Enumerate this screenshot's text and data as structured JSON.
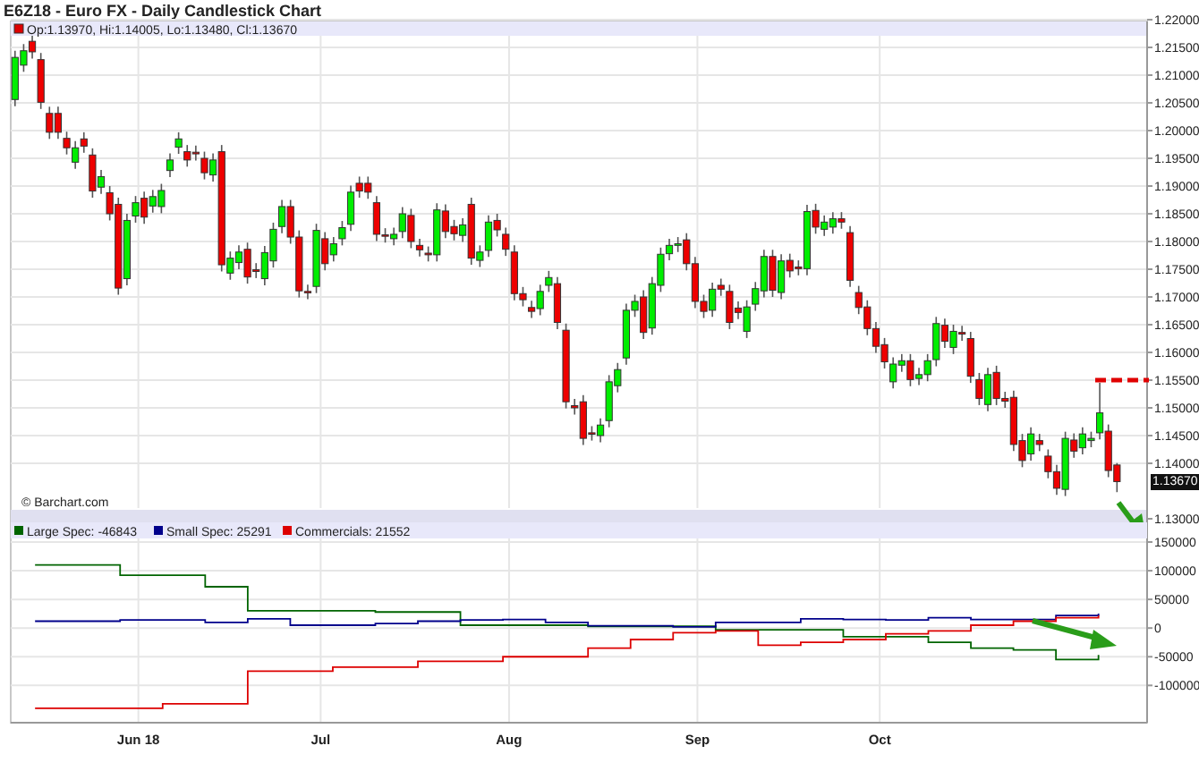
{
  "title": "E6Z18 - Euro FX - Daily Candlestick Chart",
  "price_chart": {
    "info": "Op:1.13970, Hi:1.14005, Lo:1.13480, Cl:1.13670",
    "copyright": "© Barchart.com",
    "last_price_label": "1.13670",
    "chart_data": {
      "type": "candlestick",
      "grid": true,
      "ylim": [
        1.13,
        1.22
      ],
      "categories": [
        null,
        null,
        null,
        null,
        null,
        null,
        null,
        null,
        null,
        null,
        null,
        null,
        null,
        null,
        null,
        null,
        null,
        null,
        null,
        null,
        null,
        null,
        null,
        null,
        null,
        null,
        null,
        null,
        null,
        null,
        null,
        null,
        null,
        null,
        null,
        null,
        null,
        null,
        null,
        null,
        null,
        null,
        null,
        null,
        null,
        null,
        null,
        null,
        null,
        null,
        null,
        null,
        null,
        null,
        null,
        null,
        null,
        null,
        null,
        null,
        null,
        null,
        null,
        null,
        null,
        null,
        null,
        null,
        null,
        null,
        null,
        null,
        null,
        null,
        null,
        null,
        null,
        null,
        null,
        null,
        null,
        null,
        null,
        null,
        null,
        null,
        null,
        null,
        null,
        null,
        null,
        null,
        null,
        null,
        null,
        null,
        null,
        null,
        null,
        null,
        null,
        null,
        null,
        null,
        null,
        null,
        null,
        null,
        null,
        null,
        null,
        null,
        null,
        null,
        null,
        null,
        null,
        null,
        null,
        null,
        null,
        null,
        null,
        null,
        null,
        null,
        null,
        null,
        null,
        null,
        null,
        null
      ],
      "ohlc": [
        [
          1.2056,
          1.2144,
          1.2044,
          1.2132
        ],
        [
          1.2118,
          1.2156,
          1.2106,
          1.2144
        ],
        [
          1.2161,
          1.2173,
          1.213,
          1.2142
        ],
        [
          1.2128,
          1.214,
          1.2039,
          1.2051
        ],
        [
          1.2031,
          1.2043,
          1.1985,
          1.1997
        ],
        [
          1.2031,
          1.2043,
          1.1985,
          1.1997
        ],
        [
          1.1986,
          1.1998,
          1.1957,
          1.1969
        ],
        [
          1.1943,
          1.1981,
          1.1931,
          1.1969
        ],
        [
          1.1985,
          1.1997,
          1.196,
          1.1972
        ],
        [
          1.1956,
          1.1968,
          1.1879,
          1.1891
        ],
        [
          1.1898,
          1.1929,
          1.1886,
          1.1917
        ],
        [
          1.1888,
          1.19,
          1.1838,
          1.185
        ],
        [
          1.1867,
          1.1879,
          1.1704,
          1.1716
        ],
        [
          1.1733,
          1.185,
          1.1721,
          1.1838
        ],
        [
          1.1846,
          1.1882,
          1.1834,
          1.187
        ],
        [
          1.1878,
          1.189,
          1.1832,
          1.1844
        ],
        [
          1.1864,
          1.1893,
          1.1852,
          1.1881
        ],
        [
          1.1863,
          1.1904,
          1.1851,
          1.1892
        ],
        [
          1.1928,
          1.1959,
          1.1916,
          1.1947
        ],
        [
          1.197,
          1.1997,
          1.1958,
          1.1985
        ],
        [
          1.1962,
          1.1974,
          1.1935,
          1.1947
        ],
        [
          1.1961,
          1.1973,
          1.1946,
          1.1958
        ],
        [
          1.195,
          1.1962,
          1.1912,
          1.1924
        ],
        [
          1.192,
          1.1959,
          1.1908,
          1.1947
        ],
        [
          1.1962,
          1.1974,
          1.1746,
          1.1758
        ],
        [
          1.1743,
          1.1782,
          1.1731,
          1.177
        ],
        [
          1.1762,
          1.1793,
          1.175,
          1.1781
        ],
        [
          1.1786,
          1.1798,
          1.1724,
          1.1736
        ],
        [
          1.1749,
          1.1761,
          1.1734,
          1.1746
        ],
        [
          1.1733,
          1.1792,
          1.1721,
          1.178
        ],
        [
          1.1765,
          1.1834,
          1.1753,
          1.1822
        ],
        [
          1.1827,
          1.1875,
          1.1815,
          1.1863
        ],
        [
          1.1863,
          1.1875,
          1.1796,
          1.1808
        ],
        [
          1.1808,
          1.182,
          1.1699,
          1.1711
        ],
        [
          1.171,
          1.1722,
          1.1696,
          1.1708
        ],
        [
          1.1719,
          1.1832,
          1.1707,
          1.182
        ],
        [
          1.1805,
          1.1817,
          1.1748,
          1.176
        ],
        [
          1.1776,
          1.1808,
          1.1764,
          1.1796
        ],
        [
          1.1805,
          1.1837,
          1.1793,
          1.1825
        ],
        [
          1.1831,
          1.1901,
          1.1819,
          1.1889
        ],
        [
          1.1905,
          1.1917,
          1.1879,
          1.1891
        ],
        [
          1.1905,
          1.1917,
          1.1877,
          1.1889
        ],
        [
          1.187,
          1.1882,
          1.1801,
          1.1813
        ],
        [
          1.1812,
          1.1824,
          1.1798,
          1.181
        ],
        [
          1.1805,
          1.1825,
          1.1793,
          1.1813
        ],
        [
          1.1818,
          1.1862,
          1.1806,
          1.185
        ],
        [
          1.1847,
          1.1859,
          1.1788,
          1.18
        ],
        [
          1.1793,
          1.1805,
          1.1773,
          1.1785
        ],
        [
          1.1779,
          1.1791,
          1.1764,
          1.1776
        ],
        [
          1.1776,
          1.1869,
          1.1764,
          1.1857
        ],
        [
          1.1855,
          1.1867,
          1.1806,
          1.1818
        ],
        [
          1.1827,
          1.1839,
          1.1802,
          1.1814
        ],
        [
          1.1811,
          1.1842,
          1.1799,
          1.183
        ],
        [
          1.1867,
          1.1879,
          1.1758,
          1.177
        ],
        [
          1.1766,
          1.1793,
          1.1754,
          1.1781
        ],
        [
          1.1784,
          1.1847,
          1.1772,
          1.1835
        ],
        [
          1.1838,
          1.185,
          1.1809,
          1.1821
        ],
        [
          1.1813,
          1.1825,
          1.1774,
          1.1786
        ],
        [
          1.1781,
          1.1793,
          1.1694,
          1.1706
        ],
        [
          1.1706,
          1.1718,
          1.1683,
          1.1695
        ],
        [
          1.1681,
          1.1693,
          1.1662,
          1.1674
        ],
        [
          1.1679,
          1.1722,
          1.1667,
          1.171
        ],
        [
          1.1721,
          1.1747,
          1.1709,
          1.1735
        ],
        [
          1.1724,
          1.1736,
          1.1642,
          1.1654
        ],
        [
          1.164,
          1.1652,
          1.1499,
          1.1511
        ],
        [
          1.1504,
          1.1516,
          1.1488,
          1.15
        ],
        [
          1.1511,
          1.1523,
          1.1433,
          1.1445
        ],
        [
          1.1455,
          1.1467,
          1.1441,
          1.1453
        ],
        [
          1.145,
          1.1481,
          1.1438,
          1.1469
        ],
        [
          1.1477,
          1.1559,
          1.1465,
          1.1547
        ],
        [
          1.154,
          1.1581,
          1.1528,
          1.1569
        ],
        [
          1.159,
          1.1688,
          1.1578,
          1.1676
        ],
        [
          1.1676,
          1.1704,
          1.1664,
          1.1692
        ],
        [
          1.17,
          1.1712,
          1.1624,
          1.1636
        ],
        [
          1.1644,
          1.1736,
          1.1632,
          1.1724
        ],
        [
          1.1721,
          1.1789,
          1.1709,
          1.1777
        ],
        [
          1.1778,
          1.1805,
          1.1766,
          1.1793
        ],
        [
          1.1793,
          1.1808,
          1.1781,
          1.1796
        ],
        [
          1.1803,
          1.1815,
          1.1748,
          1.176
        ],
        [
          1.176,
          1.1772,
          1.168,
          1.1692
        ],
        [
          1.1692,
          1.1704,
          1.1662,
          1.1674
        ],
        [
          1.1676,
          1.1726,
          1.1664,
          1.1714
        ],
        [
          1.1721,
          1.1733,
          1.1702,
          1.1714
        ],
        [
          1.171,
          1.1722,
          1.1642,
          1.1654
        ],
        [
          1.168,
          1.1692,
          1.166,
          1.1672
        ],
        [
          1.1638,
          1.1694,
          1.1626,
          1.1682
        ],
        [
          1.1687,
          1.1727,
          1.1675,
          1.1715
        ],
        [
          1.1711,
          1.1785,
          1.1699,
          1.1773
        ],
        [
          1.1773,
          1.1785,
          1.17,
          1.1712
        ],
        [
          1.1708,
          1.1777,
          1.1696,
          1.1765
        ],
        [
          1.1766,
          1.1778,
          1.1735,
          1.1747
        ],
        [
          1.1754,
          1.1766,
          1.1739,
          1.1751
        ],
        [
          1.1751,
          1.1866,
          1.1739,
          1.1854
        ],
        [
          1.1856,
          1.1868,
          1.1814,
          1.1826
        ],
        [
          1.1822,
          1.1847,
          1.181,
          1.1835
        ],
        [
          1.1826,
          1.1853,
          1.1814,
          1.1841
        ],
        [
          1.1841,
          1.1853,
          1.1823,
          1.1835
        ],
        [
          1.1816,
          1.1828,
          1.1718,
          1.173
        ],
        [
          1.1708,
          1.172,
          1.1669,
          1.1681
        ],
        [
          1.1682,
          1.1694,
          1.1631,
          1.1643
        ],
        [
          1.1643,
          1.1655,
          1.1599,
          1.1611
        ],
        [
          1.1614,
          1.1626,
          1.1571,
          1.1583
        ],
        [
          1.1547,
          1.1591,
          1.1535,
          1.1579
        ],
        [
          1.1577,
          1.1597,
          1.1565,
          1.1585
        ],
        [
          1.1585,
          1.1597,
          1.1539,
          1.1551
        ],
        [
          1.1553,
          1.1572,
          1.1541,
          1.156
        ],
        [
          1.156,
          1.1597,
          1.1548,
          1.1585
        ],
        [
          1.1587,
          1.1664,
          1.1575,
          1.1652
        ],
        [
          1.1649,
          1.1661,
          1.1608,
          1.162
        ],
        [
          1.1609,
          1.165,
          1.1597,
          1.1638
        ],
        [
          1.1636,
          1.1648,
          1.1621,
          1.1633
        ],
        [
          1.1625,
          1.1637,
          1.1545,
          1.1557
        ],
        [
          1.1551,
          1.1563,
          1.1505,
          1.1517
        ],
        [
          1.1506,
          1.1572,
          1.1494,
          1.156
        ],
        [
          1.1564,
          1.1576,
          1.1505,
          1.1517
        ],
        [
          1.1517,
          1.1529,
          1.15,
          1.1512
        ],
        [
          1.1519,
          1.1531,
          1.1422,
          1.1434
        ],
        [
          1.1441,
          1.1453,
          1.1393,
          1.1405
        ],
        [
          1.1417,
          1.1465,
          1.1405,
          1.1453
        ],
        [
          1.1441,
          1.1453,
          1.1422,
          1.1434
        ],
        [
          1.1413,
          1.1425,
          1.1373,
          1.1385
        ],
        [
          1.1385,
          1.1397,
          1.1343,
          1.1355
        ],
        [
          1.1353,
          1.1457,
          1.1341,
          1.1445
        ],
        [
          1.1442,
          1.1454,
          1.141,
          1.1422
        ],
        [
          1.1428,
          1.1465,
          1.1416,
          1.1453
        ],
        [
          1.1441,
          1.1457,
          1.1429,
          1.1445
        ],
        [
          1.1455,
          1.1545,
          1.1443,
          1.1491
        ],
        [
          1.1458,
          1.147,
          1.1375,
          1.1387
        ],
        [
          1.1397,
          1.14005,
          1.1348,
          1.1367
        ],
        null,
        null,
        null
      ],
      "yticks": [
        {
          "value": 1.22,
          "label": "1.22000"
        },
        {
          "value": 1.215,
          "label": "1.21500"
        },
        {
          "value": 1.21,
          "label": "1.21000"
        },
        {
          "value": 1.205,
          "label": "1.20500"
        },
        {
          "value": 1.2,
          "label": "1.20000"
        },
        {
          "value": 1.195,
          "label": "1.19500"
        },
        {
          "value": 1.19,
          "label": "1.19000"
        },
        {
          "value": 1.185,
          "label": "1.18500"
        },
        {
          "value": 1.18,
          "label": "1.18000"
        },
        {
          "value": 1.175,
          "label": "1.17500"
        },
        {
          "value": 1.17,
          "label": "1.17000"
        },
        {
          "value": 1.165,
          "label": "1.16500"
        },
        {
          "value": 1.16,
          "label": "1.16000"
        },
        {
          "value": 1.155,
          "label": "1.15500"
        },
        {
          "value": 1.15,
          "label": "1.15000"
        },
        {
          "value": 1.145,
          "label": "1.14500"
        },
        {
          "value": 1.14,
          "label": "1.14000"
        },
        {
          "value": 1.13,
          "label": "1.13000"
        }
      ]
    }
  },
  "cot_chart": {
    "chart_data": {
      "type": "line",
      "grid": true,
      "xlim": [
        "2018-05-11",
        "2018-11-14"
      ],
      "ylim": [
        -165000,
        150000
      ],
      "x": [
        "2018-05-15",
        "2018-05-22",
        "2018-05-22",
        "2018-05-29",
        "2018-05-29",
        "2018-06-05",
        "2018-06-05",
        "2018-06-12",
        "2018-06-12",
        "2018-06-19",
        "2018-06-19",
        "2018-06-26",
        "2018-06-26",
        "2018-07-03",
        "2018-07-03",
        "2018-07-10",
        "2018-07-10",
        "2018-07-17",
        "2018-07-17",
        "2018-07-24",
        "2018-07-24",
        "2018-07-31",
        "2018-07-31",
        "2018-08-07",
        "2018-08-07",
        "2018-08-14",
        "2018-08-14",
        "2018-08-21",
        "2018-08-21",
        "2018-08-28",
        "2018-08-28",
        "2018-09-04",
        "2018-09-04",
        "2018-09-11",
        "2018-09-11",
        "2018-09-18",
        "2018-09-18",
        "2018-09-25",
        "2018-09-25",
        "2018-10-02",
        "2018-10-02",
        "2018-10-09",
        "2018-10-09",
        "2018-10-16",
        "2018-10-16",
        "2018-10-23",
        "2018-10-23",
        "2018-10-30",
        "2018-10-30",
        "2018-11-06",
        "2018-11-06"
      ],
      "series": [
        {
          "name": "Large Spec: -46843",
          "color": "#006400",
          "values": [
            110000,
            110000,
            110000,
            110000,
            92000,
            92000,
            92000,
            92000,
            72000,
            72000,
            30000,
            30000,
            30000,
            30000,
            30000,
            30000,
            28000,
            28000,
            28000,
            28000,
            5000,
            5000,
            5000,
            5000,
            5000,
            5000,
            3000,
            3000,
            3000,
            3000,
            3000,
            3000,
            -3000,
            -3000,
            -3000,
            -3000,
            -3000,
            -3000,
            -15000,
            -15000,
            -15000,
            -15000,
            -25000,
            -25000,
            -35000,
            -35000,
            -38000,
            -38000,
            -55000,
            -55000,
            -46843
          ]
        },
        {
          "name": "Small Spec: 25291",
          "color": "#00008b",
          "values": [
            12000,
            12000,
            12000,
            12000,
            14000,
            14000,
            14000,
            14000,
            10000,
            10000,
            16000,
            16000,
            5000,
            5000,
            5000,
            5000,
            8000,
            8000,
            12000,
            12000,
            14000,
            14000,
            15000,
            15000,
            10000,
            10000,
            4000,
            4000,
            4000,
            4000,
            2000,
            2000,
            10000,
            10000,
            10000,
            10000,
            16000,
            16000,
            15000,
            15000,
            14000,
            14000,
            18000,
            18000,
            15000,
            15000,
            15000,
            15000,
            22000,
            22000,
            25291
          ]
        },
        {
          "name": "Commercials: 21552",
          "color": "#dd0000",
          "values": [
            -140000,
            -140000,
            -140000,
            -140000,
            -140000,
            -140000,
            -132000,
            -132000,
            -132000,
            -132000,
            -75000,
            -75000,
            -75000,
            -75000,
            -68000,
            -68000,
            -68000,
            -68000,
            -58000,
            -58000,
            -58000,
            -58000,
            -50000,
            -50000,
            -50000,
            -50000,
            -35000,
            -35000,
            -20000,
            -20000,
            -8000,
            -8000,
            -5000,
            -5000,
            -30000,
            -30000,
            -25000,
            -25000,
            -20000,
            -20000,
            -10000,
            -10000,
            -5000,
            -5000,
            5000,
            5000,
            12000,
            12000,
            18000,
            18000,
            21552
          ]
        }
      ],
      "xticks": [
        {
          "value": "2018-06-01",
          "label": "Jun 18"
        },
        {
          "value": "2018-07-01",
          "label": "Jul"
        },
        {
          "value": "2018-08-01",
          "label": "Aug"
        },
        {
          "value": "2018-09-01",
          "label": "Sep"
        },
        {
          "value": "2018-10-01",
          "label": "Oct"
        }
      ],
      "yticks": [
        {
          "value": 150000,
          "label": "150000"
        },
        {
          "value": 100000,
          "label": "100000"
        },
        {
          "value": 50000,
          "label": "50000"
        },
        {
          "value": 0,
          "label": "0"
        },
        {
          "value": -50000,
          "label": "-50000"
        },
        {
          "value": -100000,
          "label": "-100000"
        }
      ]
    }
  }
}
